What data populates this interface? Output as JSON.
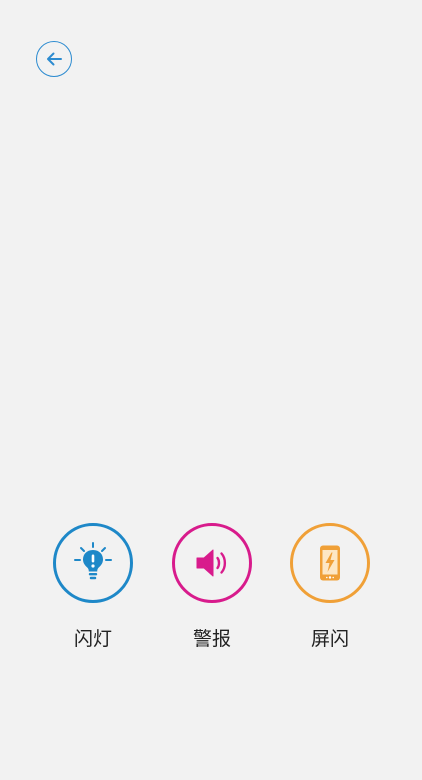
{
  "header": {
    "back_icon": "arrow-left-icon",
    "back_color": "#2c8bd0"
  },
  "actions": [
    {
      "label": "闪灯",
      "icon": "lightbulb-alert-icon",
      "color": "#1e88c8"
    },
    {
      "label": "警报",
      "icon": "speaker-icon",
      "color": "#d81b8c"
    },
    {
      "label": "屏闪",
      "icon": "phone-flash-icon",
      "color": "#f0a037"
    }
  ],
  "colors": {
    "background": "#f2f2f2",
    "text": "#222222"
  }
}
